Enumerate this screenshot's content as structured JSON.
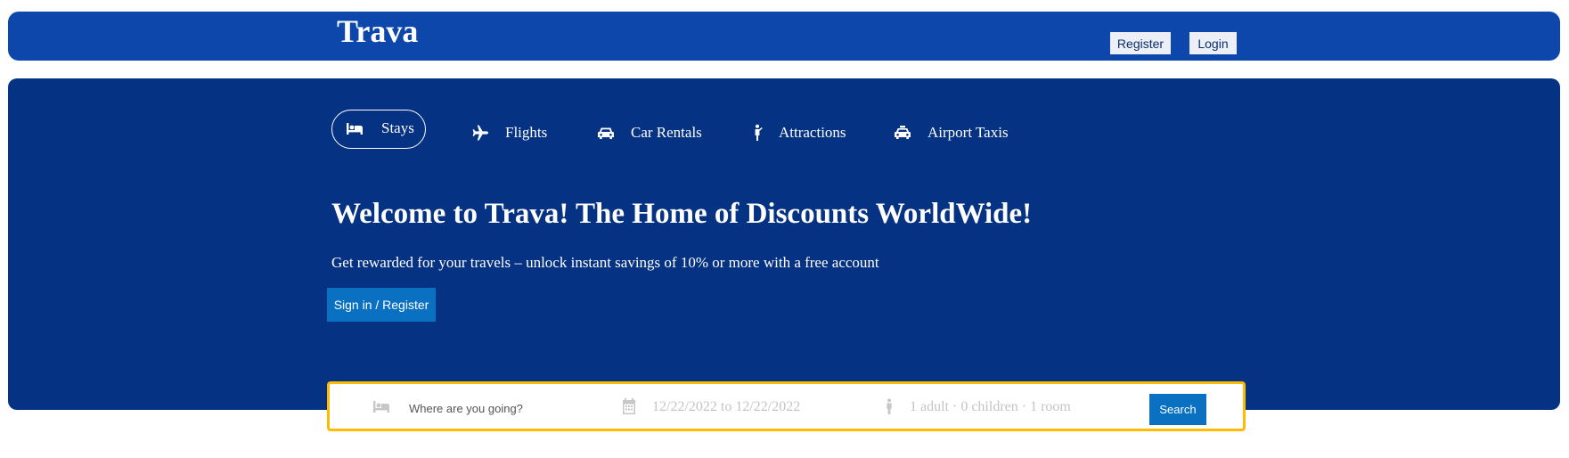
{
  "header": {
    "logo": "Trava",
    "register_label": "Register",
    "login_label": "Login"
  },
  "tabs": [
    {
      "label": "Stays",
      "icon": "bed-icon",
      "active": true
    },
    {
      "label": "Flights",
      "icon": "plane-icon"
    },
    {
      "label": "Car Rentals",
      "icon": "car-icon"
    },
    {
      "label": "Attractions",
      "icon": "person-icon"
    },
    {
      "label": "Airport Taxis",
      "icon": "taxi-icon"
    }
  ],
  "hero": {
    "title": "Welcome to Trava! The Home of Discounts WorldWide!",
    "subtitle": "Get rewarded for your travels – unlock instant savings of 10% or more with a free account",
    "cta_label": "Sign in / Register"
  },
  "search": {
    "destination_placeholder": "Where are you going?",
    "dates": "12/22/2022 to 12/22/2022",
    "guests": "1 adult · 0 children · 1 room",
    "button_label": "Search"
  },
  "colors": {
    "navbar": "#0d47ab",
    "hero": "#053282",
    "accent_button": "#0a71c2",
    "search_border": "#febb02"
  }
}
